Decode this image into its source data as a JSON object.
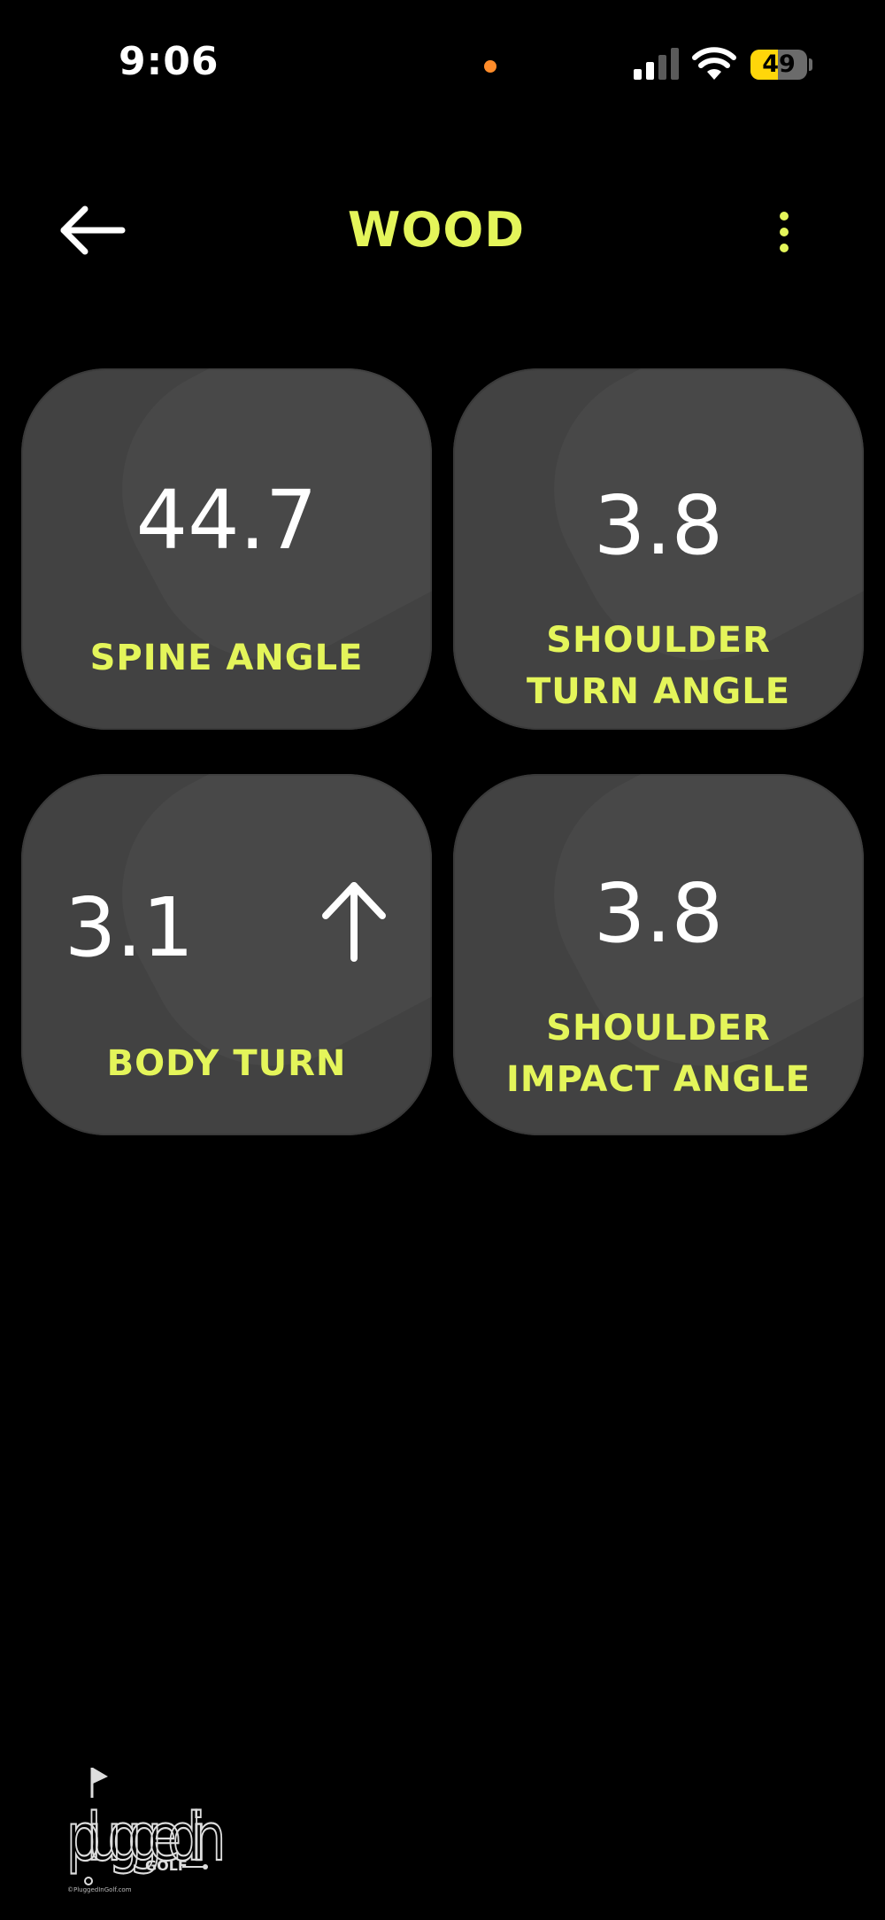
{
  "status_bar": {
    "time": "9:06",
    "battery_level": "49",
    "battery_fraction": 0.49,
    "signal_bars_active": 2,
    "signal_bars_total": 4,
    "privacy_indicator_color": "#ff8c2a",
    "battery_fill_color": "#ffd60a"
  },
  "header": {
    "back_icon": "arrow-left-icon",
    "title": "WOOD",
    "menu_icon": "more-vertical-icon"
  },
  "metrics": [
    {
      "value": "44.7",
      "label_lines": [
        "SPINE ANGLE"
      ]
    },
    {
      "value": "3.8",
      "label_lines": [
        "SHOULDER",
        "TURN ANGLE"
      ]
    },
    {
      "value": "3.1",
      "label_lines": [
        "BODY TURN"
      ],
      "icon": "arrow-up-icon"
    },
    {
      "value": "3.8",
      "label_lines": [
        "SHOULDER",
        "IMPACT ANGLE"
      ]
    }
  ],
  "watermark": {
    "logo_text": "plugged in",
    "logo_subtext": "GOLF",
    "copyright": "©PluggedInGolf.com"
  },
  "colors": {
    "accent": "#e4f55a",
    "background": "#000000",
    "card": "#424242",
    "text": "#ffffff"
  }
}
